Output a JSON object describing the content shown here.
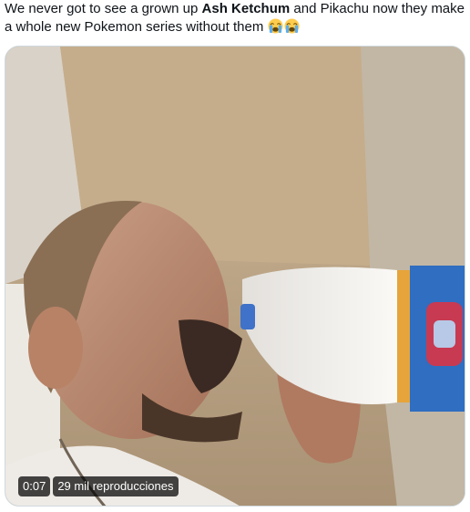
{
  "tweet": {
    "text_before": "We never got to see a grown up ",
    "text_bold": "Ash Ketchum",
    "text_after": " and Pikachu now they make a whole new Pokemon series without them",
    "emojis": [
      "loudly-crying-face-icon",
      "loudly-crying-face-icon"
    ]
  },
  "video": {
    "duration": "0:07",
    "views": "29 mil reproducciones"
  }
}
